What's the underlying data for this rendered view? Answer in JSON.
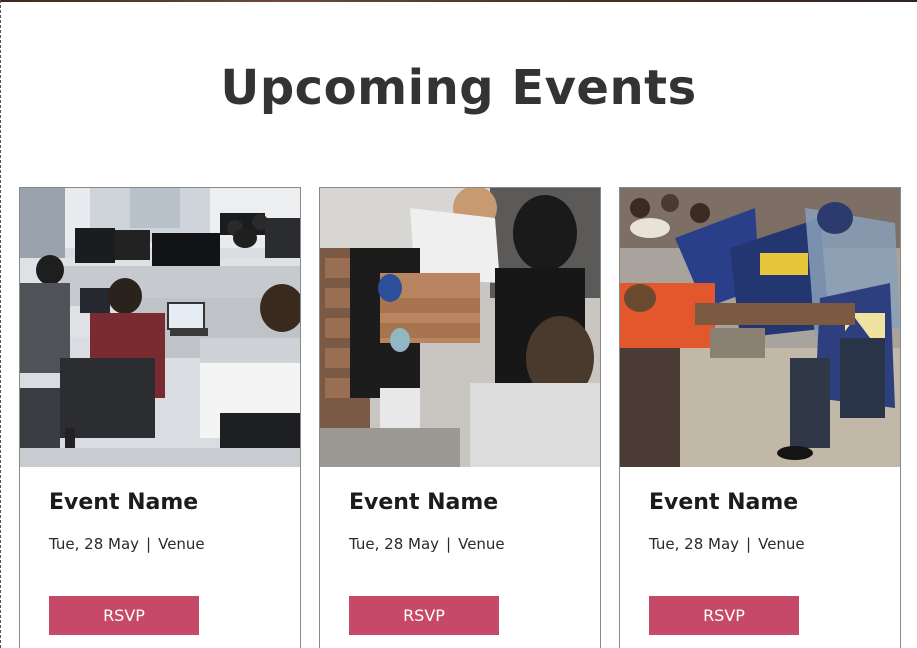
{
  "section": {
    "title": "Upcoming Events"
  },
  "events": [
    {
      "name": "Event Name",
      "date": "Tue, 28 May",
      "separator": "|",
      "venue": "Venue",
      "rsvp_label": "RSVP",
      "image": "computer-lab-photo"
    },
    {
      "name": "Event Name",
      "date": "Tue, 28 May",
      "separator": "|",
      "venue": "Venue",
      "rsvp_label": "RSVP",
      "image": "volunteers-boxes-photo"
    },
    {
      "name": "Event Name",
      "date": "Tue, 28 May",
      "separator": "|",
      "venue": "Venue",
      "rsvp_label": "RSVP",
      "image": "riot-police-photo"
    }
  ],
  "colors": {
    "accent": "#c64a67",
    "heading": "#333333",
    "card_border": "#8a8a8a"
  }
}
